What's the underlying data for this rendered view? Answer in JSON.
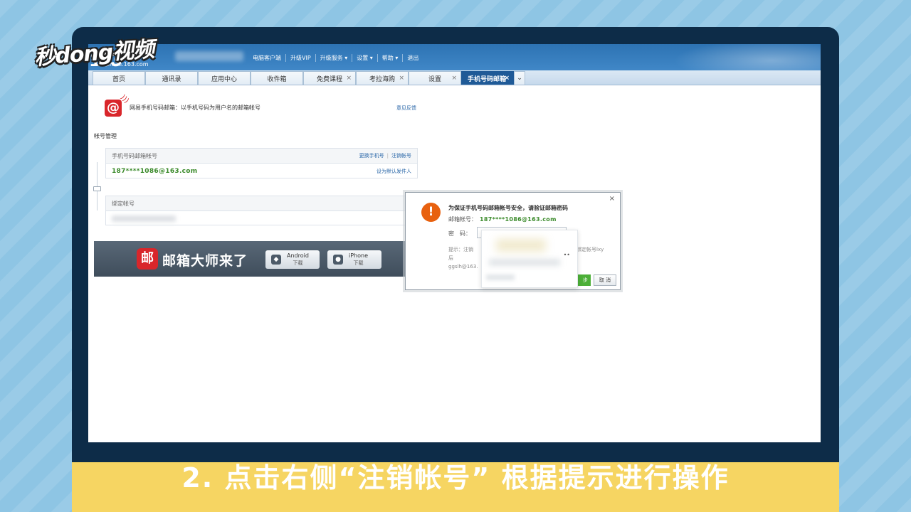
{
  "watermark": "秒dong视频",
  "header": {
    "logo": "163",
    "domain": "mail.163.com",
    "top_links": [
      "电脑客户端",
      "升级VIP",
      "升级服务 ▾",
      "设置 ▾",
      "帮助 ▾",
      "退出"
    ]
  },
  "tabs": [
    {
      "label": "首页",
      "closable": false
    },
    {
      "label": "通讯录",
      "closable": false
    },
    {
      "label": "应用中心",
      "closable": false
    },
    {
      "label": "收件箱",
      "closable": false
    },
    {
      "label": "免费课程",
      "closable": true
    },
    {
      "label": "考拉海购",
      "closable": true
    },
    {
      "label": "设置",
      "closable": true
    },
    {
      "label": "手机号码邮箱",
      "closable": true,
      "active": true
    }
  ],
  "tabs_more": "⌄",
  "content": {
    "intro": "网易手机号码邮箱：以手机号码为用户名的邮箱帐号",
    "feedback": "意见反馈",
    "section_title": "帐号管理",
    "account_box": {
      "header": "手机号码邮箱帐号",
      "change_phone": "更换手机号",
      "separator": "|",
      "cancel_account": "注销帐号",
      "email": "187****1086@163.com",
      "set_default": "设为默认发件人"
    },
    "bind_box": {
      "header": "绑定帐号"
    },
    "banner": {
      "logo_char": "邮",
      "title": "邮箱大师来了",
      "buttons": [
        {
          "name": "Android",
          "sub": "下载",
          "icon": "android-icon"
        },
        {
          "name": "iPhone",
          "sub": "下载",
          "icon": "apple-icon"
        }
      ]
    }
  },
  "dialog": {
    "close": "×",
    "warn": "!",
    "title": "为保证手机号码邮箱帐号安全，请验证邮箱密码",
    "account_label": "邮箱帐号：",
    "account_value": "187****1086@163.com",
    "password_label": "密　码：",
    "hint_left": "提示：注销后",
    "hint_right": "绑定帐号lxy",
    "hint_line2": "ggslh@163.",
    "dots": "••",
    "next": "步",
    "cancel": "取 消"
  },
  "caption": "2. 点击右侧“注销帐号” 根据提示进行操作",
  "colors": {
    "accent": "#1f5a97",
    "caption_bar": "#f6d562",
    "warn": "#e8610f",
    "email_green": "#3a8a2a"
  }
}
